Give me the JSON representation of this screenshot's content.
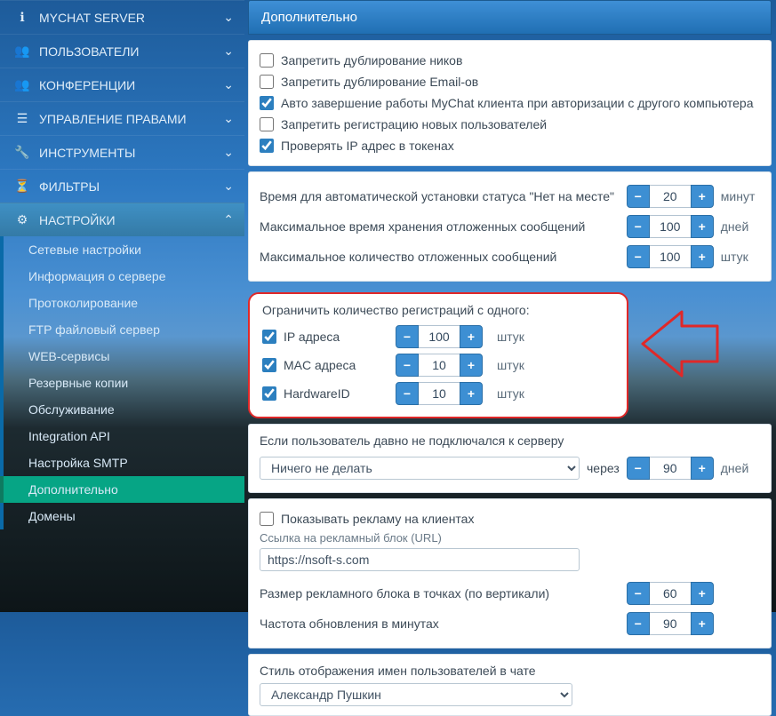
{
  "sidebar": {
    "groups": [
      {
        "id": "server",
        "label": "MYCHAT SERVER",
        "icon": "ℹ"
      },
      {
        "id": "users",
        "label": "ПОЛЬЗОВАТЕЛИ",
        "icon": "👥"
      },
      {
        "id": "conferences",
        "label": "КОНФЕРЕНЦИИ",
        "icon": "👥"
      },
      {
        "id": "rights",
        "label": "УПРАВЛЕНИЕ ПРАВАМИ",
        "icon": "☰"
      },
      {
        "id": "tools",
        "label": "ИНСТРУМЕНТЫ",
        "icon": "🔧"
      },
      {
        "id": "filters",
        "label": "ФИЛЬТРЫ",
        "icon": "⏳"
      },
      {
        "id": "settings",
        "label": "НАСТРОЙКИ",
        "icon": "⚙",
        "open": true
      }
    ],
    "settings_children": [
      "Сетевые настройки",
      "Информация о сервере",
      "Протоколирование",
      "FTP файловый сервер",
      "WEB-сервисы",
      "Резервные копии",
      "Обслуживание",
      "Integration API",
      "Настройка SMTP",
      "Дополнительно",
      "Домены"
    ],
    "active_child": "Дополнительно"
  },
  "page": {
    "title": "Дополнительно"
  },
  "checks": {
    "nick_dup": {
      "label": "Запретить дублирование ников",
      "checked": false
    },
    "email_dup": {
      "label": "Запретить дублирование Email-ов",
      "checked": false
    },
    "auto_exit": {
      "label": "Авто завершение работы MyChat клиента при авторизации с другого компьютера",
      "checked": true
    },
    "no_reg": {
      "label": "Запретить регистрацию новых пользователей",
      "checked": false
    },
    "check_ip": {
      "label": "Проверять IP адрес в токенах",
      "checked": true
    }
  },
  "limits": {
    "away": {
      "label": "Время для автоматической установки статуса \"Нет на месте\"",
      "value": "20",
      "unit": "минут"
    },
    "keep": {
      "label": "Максимальное время хранения отложенных сообщений",
      "value": "100",
      "unit": "дней"
    },
    "max_off": {
      "label": "Максимальное количество отложенных сообщений",
      "value": "100",
      "unit": "штук"
    }
  },
  "reg_limit": {
    "title": "Ограничить количество регистраций с одного:",
    "ip": {
      "label": "IP адреса",
      "checked": true,
      "value": "100",
      "unit": "штук"
    },
    "mac": {
      "label": "MAC адреса",
      "checked": true,
      "value": "10",
      "unit": "штук"
    },
    "hw": {
      "label": "HardwareID",
      "checked": true,
      "value": "10",
      "unit": "штук"
    }
  },
  "idle": {
    "label": "Если пользователь давно не подключался к серверу",
    "select": "Ничего не делать",
    "through": "через",
    "value": "90",
    "unit": "дней"
  },
  "ads": {
    "show": {
      "label": "Показывать рекламу на клиентах",
      "checked": false
    },
    "url_label": "Ссылка на рекламный блок (URL)",
    "url_value": "https://nsoft-s.com",
    "size": {
      "label": "Размер рекламного блока в точках (по вертикали)",
      "value": "60"
    },
    "freq": {
      "label": "Частота обновления в минутах",
      "value": "90"
    }
  },
  "names": {
    "label": "Стиль отображения имен пользователей в чате",
    "value": "Александр Пушкин"
  }
}
